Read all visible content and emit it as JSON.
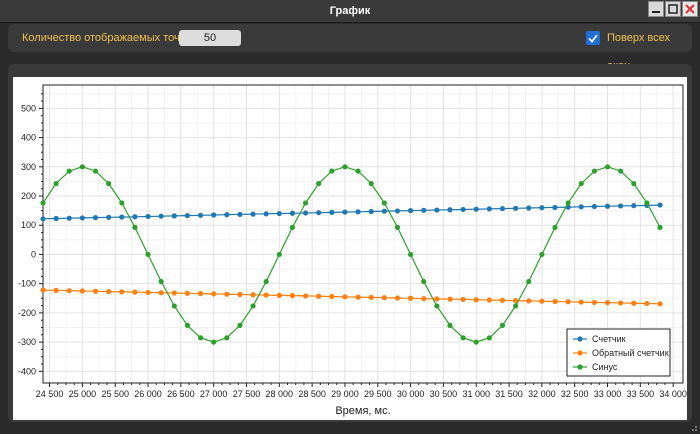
{
  "window": {
    "title": "График",
    "controls": [
      "minimize-icon",
      "maximize-icon",
      "close-icon"
    ],
    "close_color": "#e03030"
  },
  "toolbar": {
    "count_label": "Количество отображаемых точек",
    "count_value": "50",
    "on_top_label": "Поверх всех окон",
    "on_top_checked": true
  },
  "colors": {
    "accent_text": "#f0c24b",
    "checkbox": "#1e6fd8",
    "background": "#2b2b2b",
    "panel": "#3a3a3a"
  },
  "chart_data": {
    "type": "line",
    "xlabel": "Время, мс.",
    "ylabel": "",
    "xlim": [
      24400,
      34150
    ],
    "ylim": [
      -440,
      580
    ],
    "xticks": [
      24500,
      25000,
      25500,
      26000,
      26500,
      27000,
      27500,
      28000,
      28500,
      29000,
      29500,
      30000,
      30500,
      31000,
      31500,
      32000,
      32500,
      33000,
      33500,
      34000
    ],
    "xtick_labels": [
      "24 500",
      "25 000",
      "25 500",
      "26 000",
      "26 500",
      "27 000",
      "27 500",
      "28 000",
      "28 500",
      "29 000",
      "29 500",
      "30 000",
      "30 500",
      "31 000",
      "31 500",
      "32 000",
      "32 500",
      "33 000",
      "33 500",
      "34 000"
    ],
    "yticks": [
      -400,
      -300,
      -200,
      -100,
      0,
      100,
      200,
      300,
      400,
      500
    ],
    "ytick_labels": [
      "-400",
      "-300",
      "-200",
      "-100",
      "0",
      "100",
      "200",
      "300",
      "400",
      "500"
    ],
    "grid": true,
    "legend_position": "bottom-right",
    "x": {
      "start": 24400,
      "step": 200,
      "count": 48
    },
    "series": [
      {
        "name": "Счетчик",
        "color": "#1f77b4",
        "kind": "linear",
        "start": 122,
        "end": 169
      },
      {
        "name": "Обратный счетчик",
        "color": "#ff7f0e",
        "kind": "linear",
        "start": -122,
        "end": -169
      },
      {
        "name": "Синус",
        "color": "#2ca02c",
        "kind": "sine",
        "amplitude": 300,
        "period_ms": 4000,
        "peak_at_ms": 25000
      }
    ]
  }
}
